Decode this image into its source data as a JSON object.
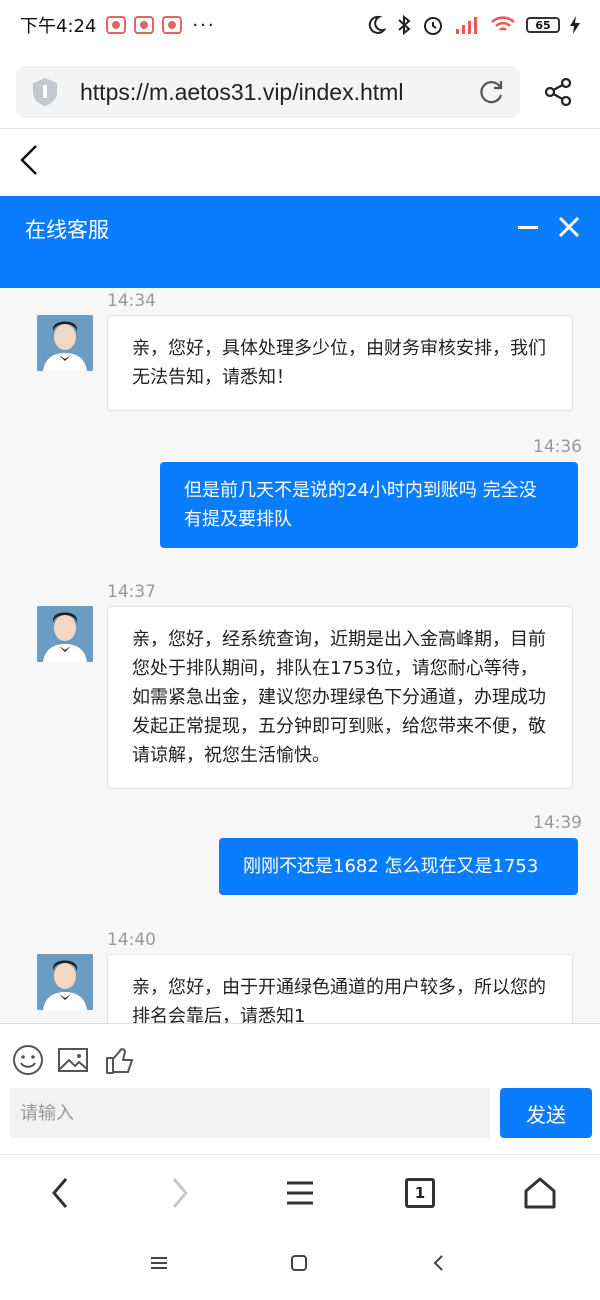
{
  "status_bar": {
    "time": "下午4:24",
    "dots": "···",
    "battery": "65"
  },
  "browser": {
    "url": "https://m.aetos31.vip/index.html"
  },
  "chat": {
    "title": "在线客服",
    "messages": [
      {
        "side": "in",
        "time": "14:34",
        "text": "亲，您好，具体处理多少位，由财务审核安排，我们无法告知，请悉知！"
      },
      {
        "side": "out",
        "time": "14:36",
        "text": "但是前几天不是说的24小时内到账吗 完全没有提及要排队"
      },
      {
        "side": "in",
        "time": "14:37",
        "text": "亲，您好，经系统查询，近期是出入金高峰期，目前您处于排队期间，排队在1753位，请您耐心等待，如需紧急出金，建议您办理绿色下分通道，办理成功发起正常提现，五分钟即可到账，给您带来不便，敬请谅解，祝您生活愉快。"
      },
      {
        "side": "out",
        "time": "14:39",
        "text": "刚刚不还是1682 怎么现在又是1753"
      },
      {
        "side": "in",
        "time": "14:40",
        "text": "亲，您好，由于开通绿色通道的用户较多，所以您的排名会靠后，请悉知1"
      }
    ],
    "input_placeholder": "请输入",
    "send_label": "发送"
  },
  "browser_nav": {
    "tab_count": "1"
  },
  "colors": {
    "accent": "#0a7cff",
    "chat_bg": "#f7f7f7"
  }
}
